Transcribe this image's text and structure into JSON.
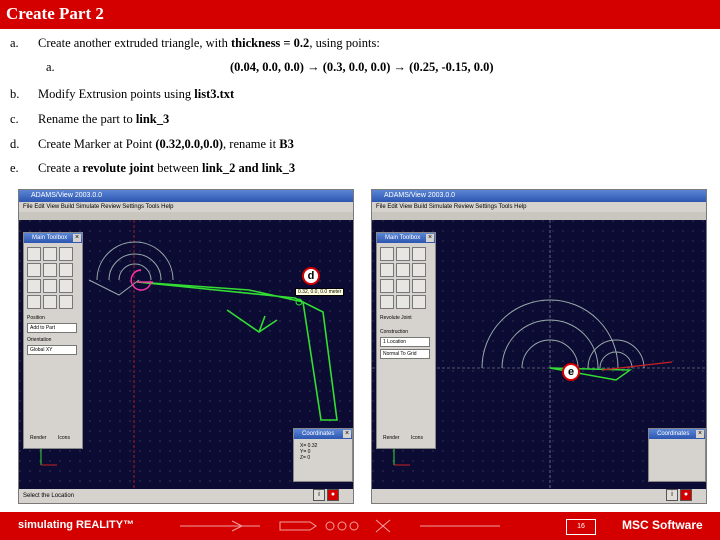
{
  "title": "Create Part 2",
  "steps": [
    {
      "label": "a.",
      "pre": "Create another extruded triangle, with ",
      "bold": "thickness = 0.2",
      "post": ", using points:"
    },
    {
      "label": "b.",
      "pre": "Modify Extrusion points using ",
      "bold": "list3.txt",
      "post": ""
    },
    {
      "label": "c.",
      "pre": "Rename the part to ",
      "bold": "link_3",
      "post": ""
    },
    {
      "label": "d.",
      "pre": "Create Marker at Point ",
      "bold": "(0.32,0.0,0.0)",
      "post": ", rename it ",
      "bold2": "B3"
    },
    {
      "label": "e.",
      "pre": "Create a ",
      "bold": "revolute joint",
      "post": " between ",
      "bold2": "link_2 and link_3"
    }
  ],
  "substep": {
    "label": "a.",
    "p1": "(0.04, 0.0, 0.0)",
    "p2": "(0.3, 0.0, 0.0)",
    "p3": "(0.25, -0.15, 0.0)",
    "arrow": "→"
  },
  "screens": {
    "left": {
      "window_title": "ADAMS/View 2003.0.0",
      "menu": "File  Edit  View  Build  Simulate  Review  Settings  Tools  Help",
      "toolbox_title": "Main Toolbox",
      "field1_label": "Position",
      "field1_value": "Add to Part",
      "field2_label": "Orientation",
      "field2_value": "Global XY",
      "btn_render": "Render",
      "btn_icons": "Icons",
      "tooltip": "0.32, 0.0, 0.0 meter",
      "callout": "d",
      "coords_title": "Coordinates",
      "coords": [
        "X=  0.32",
        "Y=  0",
        "Z=  0"
      ],
      "status": "Select the Location"
    },
    "right": {
      "window_title": "ADAMS/View 2003.0.0",
      "menu": "File  Edit  View  Build  Simulate  Review  Settings  Tools  Help",
      "toolbox_title": "Main Toolbox",
      "field0_label": "Revolute Joint",
      "field1_label": "Construction",
      "field1_value": "1 Location",
      "field2_value": "Normal To Grid",
      "btn_render": "Render",
      "btn_icons": "Icons",
      "callout": "e",
      "coords_title": "Coordinates",
      "status": ""
    }
  },
  "footer": {
    "brand": "simulating REALITY™",
    "page": "16",
    "logo": "MSC Software"
  },
  "colors": {
    "accent": "#d40000",
    "viewport": "#0b0b33",
    "geometry": "#33dd33"
  }
}
